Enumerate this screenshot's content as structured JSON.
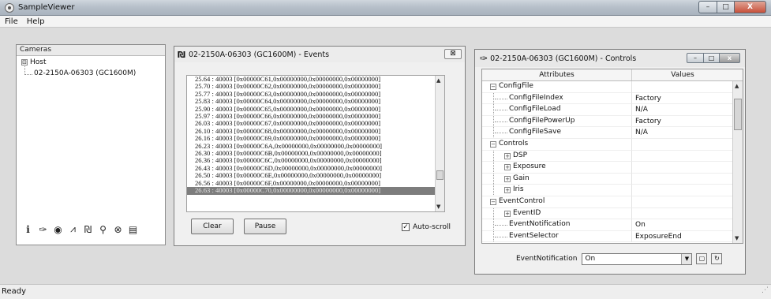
{
  "window": {
    "title": "SampleViewer",
    "min": "–",
    "max": "□",
    "close": "X"
  },
  "menu": [
    "File",
    "Help"
  ],
  "cameras": {
    "header": "Cameras",
    "host": "Host",
    "camera": "02-2150A-06303 (GC1600M)",
    "expander": "⊟",
    "toolbar_icons": [
      "info-icon",
      "wrench-icon",
      "eye-icon",
      "signal-icon",
      "events-icon",
      "network-icon",
      "gear-icon",
      "save-icon"
    ],
    "toolbar_glyphs": [
      "i",
      "✑",
      "◉",
      "⩘",
      "₪",
      "⚲",
      "⊗",
      "▤"
    ]
  },
  "events": {
    "title": "02-2150A-06303 (GC1600M) - Events",
    "close": "⊠",
    "lines": [
      "25.64 : 40003 [0x00000C61,0x00000000,0x00000000,0x00000000]",
      "25.70 : 40003 [0x00000C62,0x00000000,0x00000000,0x00000000]",
      "25.77 : 40003 [0x00000C63,0x00000000,0x00000000,0x00000000]",
      "25.83 : 40003 [0x00000C64,0x00000000,0x00000000,0x00000000]",
      "25.90 : 40003 [0x00000C65,0x00000000,0x00000000,0x00000000]",
      "25.97 : 40003 [0x00000C66,0x00000000,0x00000000,0x00000000]",
      "26.03 : 40003 [0x00000C67,0x00000000,0x00000000,0x00000000]",
      "26.10 : 40003 [0x00000C68,0x00000000,0x00000000,0x00000000]",
      "26.16 : 40003 [0x00000C69,0x00000000,0x00000000,0x00000000]",
      "26.23 : 40003 [0x00000C6A,0x00000000,0x00000000,0x00000000]",
      "26.30 : 40003 [0x00000C6B,0x00000000,0x00000000,0x00000000]",
      "26.36 : 40003 [0x00000C6C,0x00000000,0x00000000,0x00000000]",
      "26.43 : 40003 [0x00000C6D,0x00000000,0x00000000,0x00000000]",
      "26.50 : 40003 [0x00000C6E,0x00000000,0x00000000,0x00000000]",
      "26.56 : 40003 [0x00000C6F,0x00000000,0x00000000,0x00000000]",
      "26.63 : 40003 [0x00000C70,0x00000000,0x00000000,0x00000000]"
    ],
    "selected_index": 15,
    "clear_label": "Clear",
    "pause_label": "Pause",
    "autoscroll_label": "Auto-scroll",
    "autoscroll_checked": true
  },
  "controls": {
    "title": "02-2150A-06303 (GC1600M) - Controls",
    "col_attributes": "Attributes",
    "col_values": "Values",
    "rows": [
      {
        "label": "ConfigFile",
        "value": "",
        "level": 0,
        "type": "expanded"
      },
      {
        "label": "ConfigFileIndex",
        "value": "Factory",
        "level": 1,
        "type": "leaf"
      },
      {
        "label": "ConfigFileLoad",
        "value": "N/A",
        "level": 1,
        "type": "leaf"
      },
      {
        "label": "ConfigFilePowerUp",
        "value": "Factory",
        "level": 1,
        "type": "leaf"
      },
      {
        "label": "ConfigFileSave",
        "value": "N/A",
        "level": 1,
        "type": "leaf"
      },
      {
        "label": "Controls",
        "value": "",
        "level": 0,
        "type": "expanded"
      },
      {
        "label": "DSP",
        "value": "",
        "level": 1,
        "type": "collapsed"
      },
      {
        "label": "Exposure",
        "value": "",
        "level": 1,
        "type": "collapsed"
      },
      {
        "label": "Gain",
        "value": "",
        "level": 1,
        "type": "collapsed"
      },
      {
        "label": "Iris",
        "value": "",
        "level": 1,
        "type": "collapsed"
      },
      {
        "label": "EventControl",
        "value": "",
        "level": 0,
        "type": "expanded"
      },
      {
        "label": "EventID",
        "value": "",
        "level": 1,
        "type": "collapsed"
      },
      {
        "label": "EventNotification",
        "value": "On",
        "level": 1,
        "type": "leaf"
      },
      {
        "label": "EventSelector",
        "value": "ExposureEnd",
        "level": 1,
        "type": "leaf"
      }
    ],
    "bottom_label": "EventNotification",
    "bottom_value": "On"
  },
  "status": {
    "text": "Ready"
  }
}
